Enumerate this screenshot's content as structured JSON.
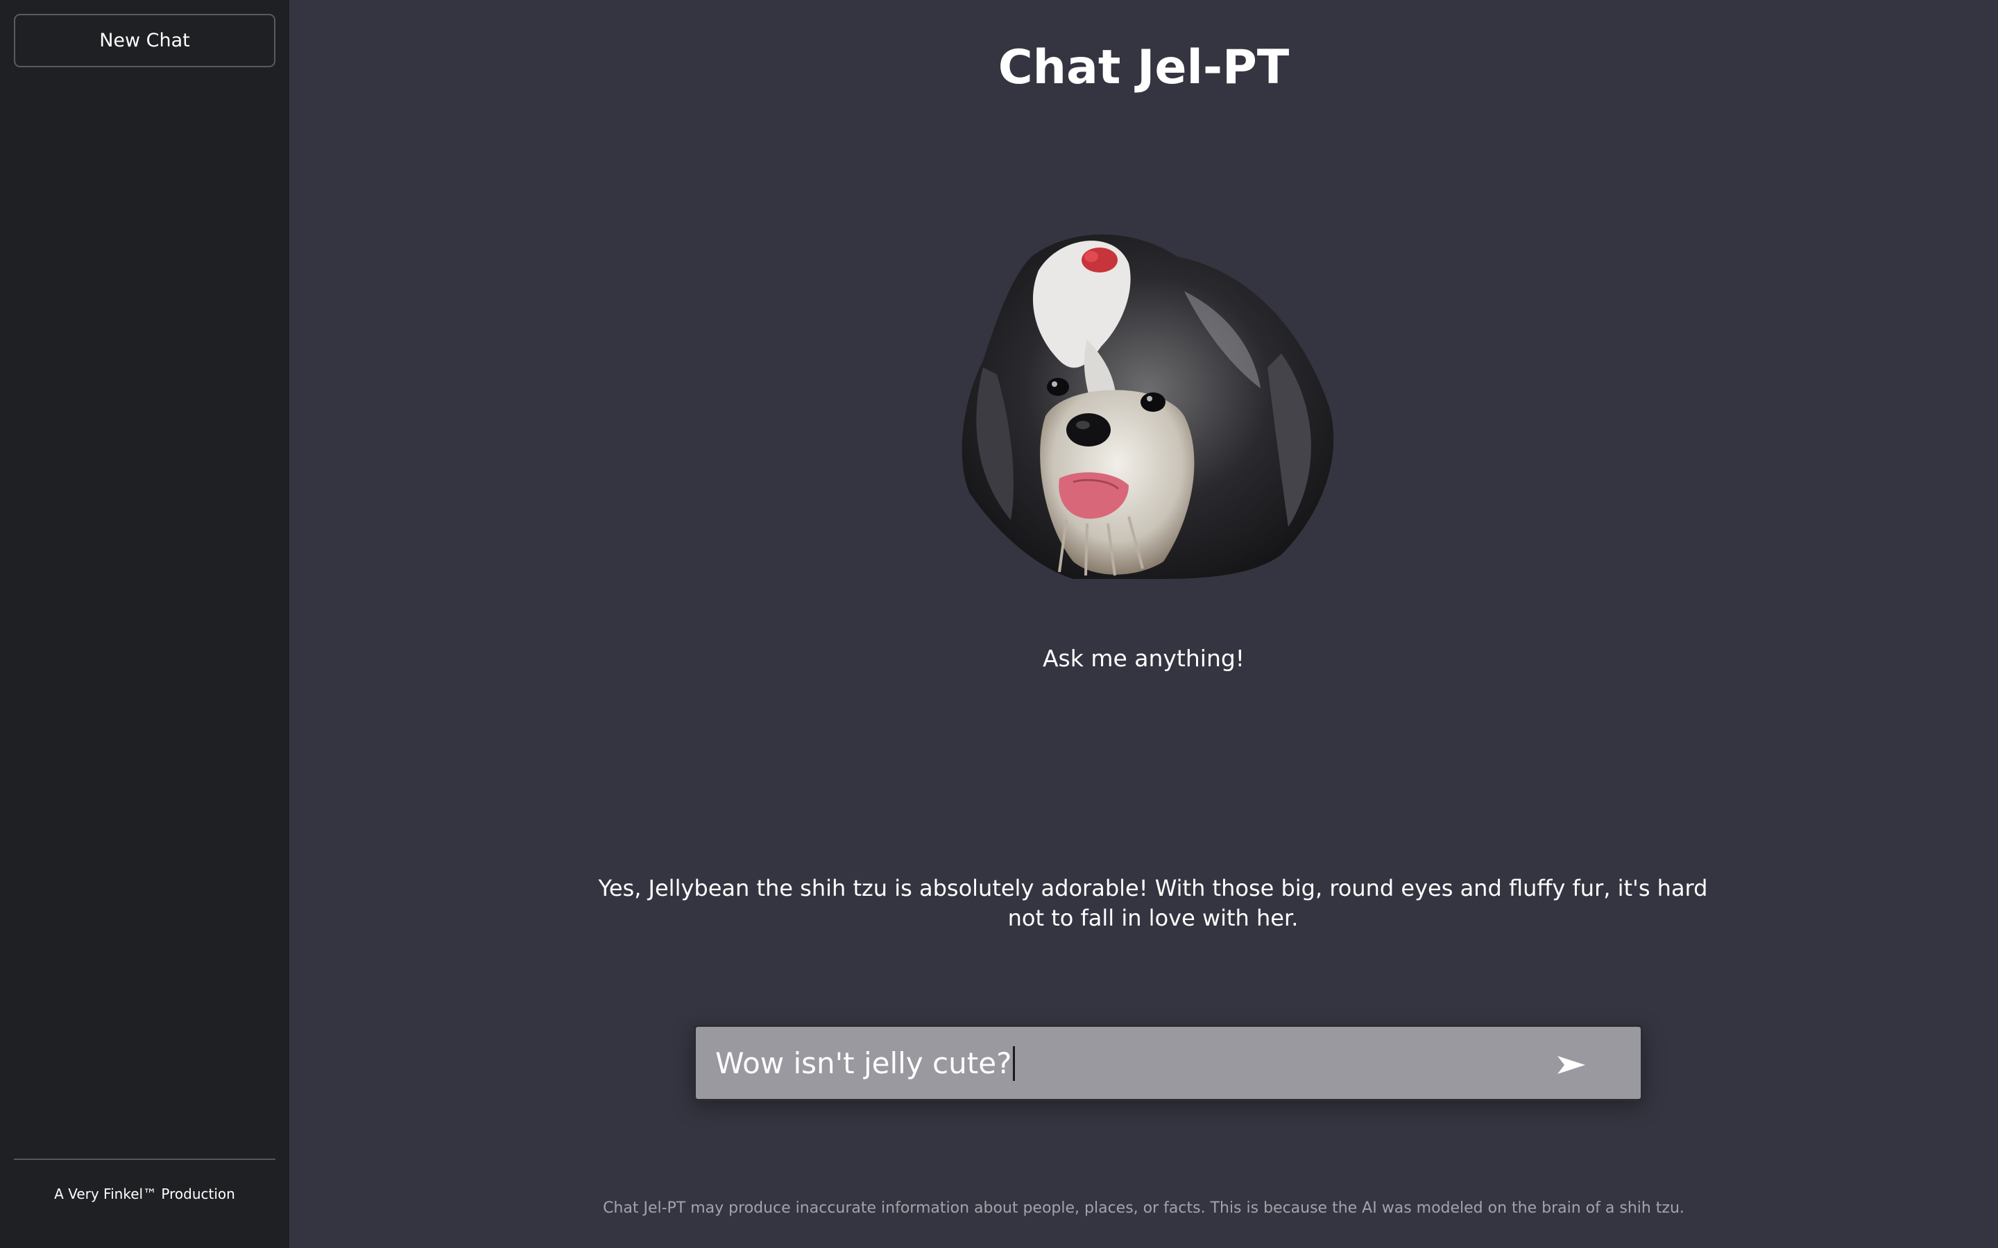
{
  "sidebar": {
    "new_chat_label": "New Chat",
    "footer": "A Very Finkel™ Production"
  },
  "main": {
    "title": "Chat Jel-PT",
    "prompt": "Ask me anything!",
    "reply": "Yes, Jellybean the shih tzu is absolutely adorable! With those big, round eyes and fluffy fur, it's hard not to fall in love with her.",
    "input_value": "Wow isn't jelly cute?",
    "send_icon": "send-arrow-icon",
    "disclaimer": "Chat Jel-PT may produce inaccurate information about people, places, or facts. This is because the AI was modeled on the brain of a shih tzu."
  },
  "colors": {
    "sidebar_bg": "#1f2023",
    "main_bg": "#353541",
    "input_bg": "#99999f",
    "text": "#ffffff",
    "muted_text": "#a2a3ab"
  }
}
